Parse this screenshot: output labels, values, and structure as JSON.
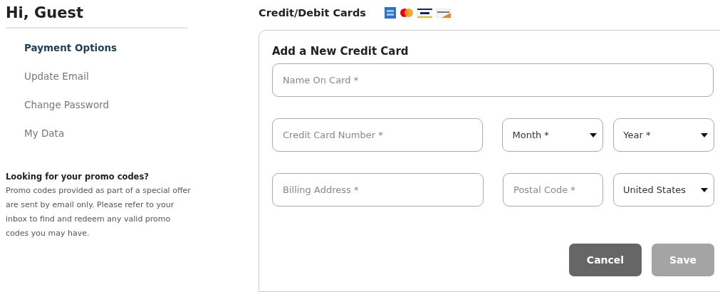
{
  "sidebar": {
    "greeting": "Hi, Guest",
    "items": [
      {
        "label": "Payment Options",
        "selected": true
      },
      {
        "label": "Update Email",
        "selected": false
      },
      {
        "label": "Change Password",
        "selected": false
      },
      {
        "label": "My Data",
        "selected": false
      }
    ],
    "promo": {
      "title": "Looking for your promo codes?",
      "text": "Promo codes provided as part of a special offer are sent by email only. Please refer to your inbox to find and redeem any valid promo codes you may have."
    }
  },
  "main": {
    "title": "Credit/Debit Cards",
    "form": {
      "title": "Add a New Credit Card",
      "rows": [
        [
          {
            "kind": "input",
            "placeholder": "Name On Card *"
          }
        ],
        [
          {
            "kind": "input",
            "placeholder": "Credit Card Number *"
          },
          {
            "kind": "select",
            "value": "Month *"
          },
          {
            "kind": "select",
            "value": "Year *"
          }
        ],
        [
          {
            "kind": "input",
            "placeholder": "Billing Address *"
          },
          {
            "kind": "input",
            "placeholder": "Postal Code *"
          },
          {
            "kind": "select",
            "value": "United States"
          }
        ]
      ],
      "buttons": [
        {
          "label": "Cancel",
          "disabled": false
        },
        {
          "label": "Save",
          "disabled": true
        }
      ]
    }
  }
}
